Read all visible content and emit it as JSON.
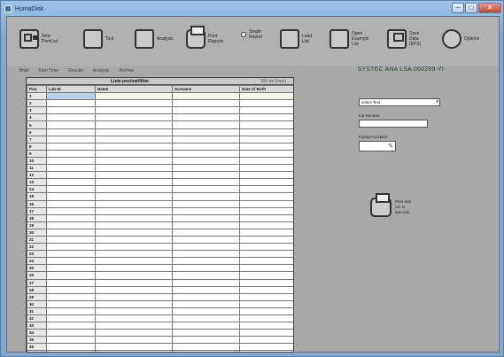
{
  "window": {
    "title": "HumaDisk",
    "minimize_icon": "minimize-icon",
    "maximize_icon": "maximize-icon",
    "close_icon": "close-icon"
  },
  "toolbar": {
    "items": [
      {
        "label": "New\nPrintList",
        "icon": "grid-icon"
      },
      {
        "label": "Tool",
        "icon": "scanner-icon"
      },
      {
        "label": "Analysis",
        "icon": "bars-icon"
      },
      {
        "label": "Print\nReports",
        "icon": "printer-icon"
      },
      {
        "label": "Single\nReport",
        "icon": "radio-icon"
      },
      {
        "label": "Load\nList",
        "icon": "folder-icon"
      },
      {
        "label": "Open\nExample\nList",
        "icon": "open-list-icon"
      },
      {
        "label": "Save\nData\n(EPS)",
        "icon": "disk-icon"
      },
      {
        "label": "Options",
        "icon": "gear-icon"
      }
    ]
  },
  "menu": [
    "Brief",
    "Start Time",
    "Results",
    "Analysis",
    "Archive"
  ],
  "brand_text": "SYSTEC ANA LSA 060289-YI",
  "worksheet": {
    "title": "Liste pos/nat/filter",
    "count": "100 tts (max)",
    "headers": [
      "Pos.",
      "Lab ID",
      "Name",
      "Surname",
      "Date of Birth"
    ],
    "rows": [
      "1",
      "2",
      "3",
      "4",
      "5",
      "6",
      "7",
      "8",
      "9",
      "10",
      "11",
      "12",
      "13",
      "14",
      "15",
      "16",
      "17",
      "18",
      "19",
      "20",
      "21",
      "22",
      "23",
      "24",
      "25",
      "26",
      "27",
      "28",
      "29",
      "30",
      "31",
      "32",
      "33",
      "34",
      "35",
      "36",
      "37"
    ]
  },
  "panel": {
    "select_test": "select Test",
    "field_1_label": "Lot Number",
    "field_2_label": "Expiry/Accepted",
    "print_label": "Print test\nrun in\nbarcode"
  }
}
